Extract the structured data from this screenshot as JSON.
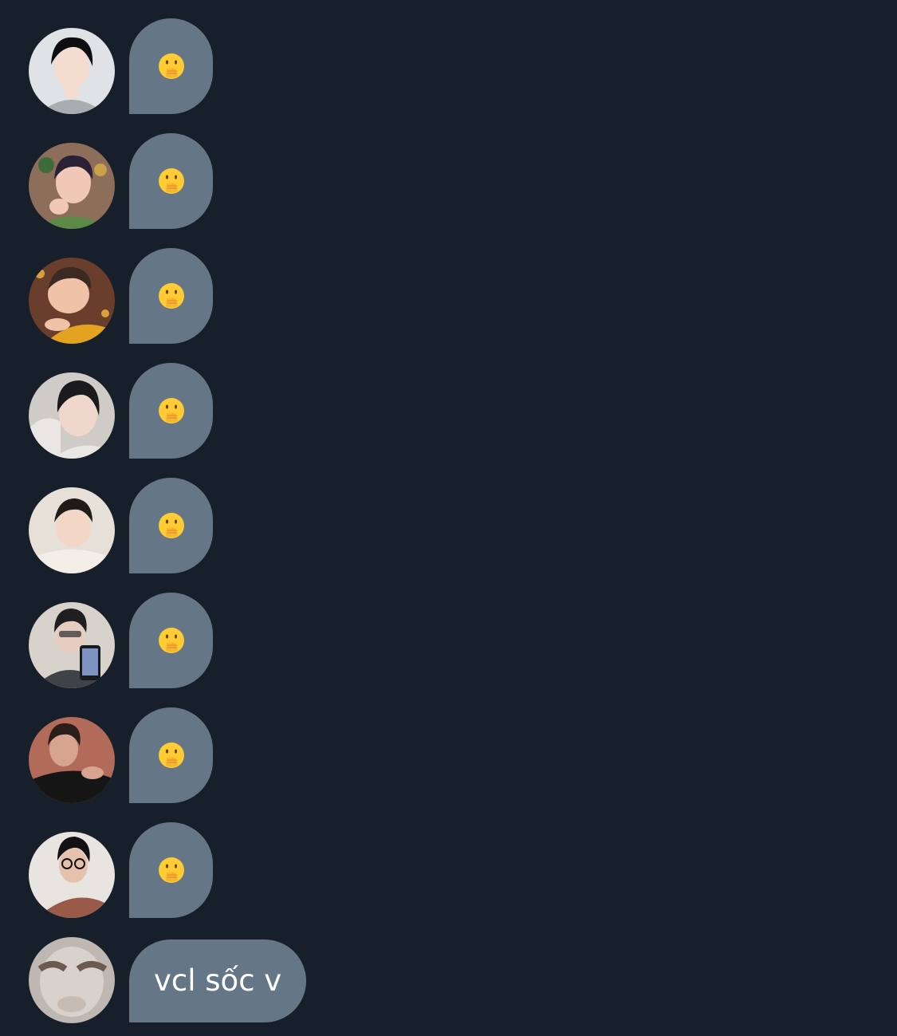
{
  "messages": [
    {
      "id": 1,
      "avatar": {
        "name": "avatar-1",
        "bg": "#dfe3e6",
        "hair": "#0e0e10",
        "skin": "#f4dcd0",
        "shirt": "#a9adb1"
      },
      "reaction_icon": "face-with-hand-over-mouth-icon"
    },
    {
      "id": 2,
      "avatar": {
        "name": "avatar-2",
        "bg": "#8c6e5a",
        "hair": "#2b2136",
        "skin": "#f1c8b8",
        "shirt": "#5c8a46"
      },
      "reaction_icon": "face-with-hand-over-mouth-icon"
    },
    {
      "id": 3,
      "avatar": {
        "name": "avatar-3",
        "bg": "#6a3e2c",
        "hair": "#3a2a22",
        "skin": "#f0c2a8",
        "shirt": "#e3a320"
      },
      "reaction_icon": "face-with-hand-over-mouth-icon"
    },
    {
      "id": 4,
      "avatar": {
        "name": "avatar-4",
        "bg": "#cfcbc7",
        "hair": "#1b1a1c",
        "skin": "#efd7cc",
        "shirt": "#e9e6e3"
      },
      "reaction_icon": "face-with-hand-over-mouth-icon"
    },
    {
      "id": 5,
      "avatar": {
        "name": "avatar-5",
        "bg": "#e6e0d8",
        "hair": "#1e1b19",
        "skin": "#f2d7c7",
        "shirt": "#f3efe8"
      },
      "reaction_icon": "face-with-hand-over-mouth-icon"
    },
    {
      "id": 6,
      "avatar": {
        "name": "avatar-6",
        "bg": "#d7d2cc",
        "hair": "#1f1e20",
        "skin": "#e7cdbf",
        "shirt": "#3f4347"
      },
      "reaction_icon": "face-with-hand-over-mouth-icon"
    },
    {
      "id": 7,
      "avatar": {
        "name": "avatar-7",
        "bg": "#b26b58",
        "hair": "#2a1e1a",
        "skin": "#d7a58f",
        "shirt": "#151515"
      },
      "reaction_icon": "face-with-hand-over-mouth-icon"
    },
    {
      "id": 8,
      "avatar": {
        "name": "avatar-8",
        "bg": "#e8e4df",
        "hair": "#121214",
        "skin": "#e6c2ae",
        "shirt": "#9a5a4a"
      },
      "reaction_icon": "face-with-hand-over-mouth-icon"
    }
  ],
  "last_message": {
    "text": "vcl sốc v",
    "avatar": {
      "name": "avatar-9",
      "bg": "#bfb8b2",
      "face": "#d9d2cc",
      "marks": "#6b5a4d"
    }
  },
  "colors": {
    "background": "#17202a",
    "bubble": "#657786",
    "text": "#ffffff"
  }
}
